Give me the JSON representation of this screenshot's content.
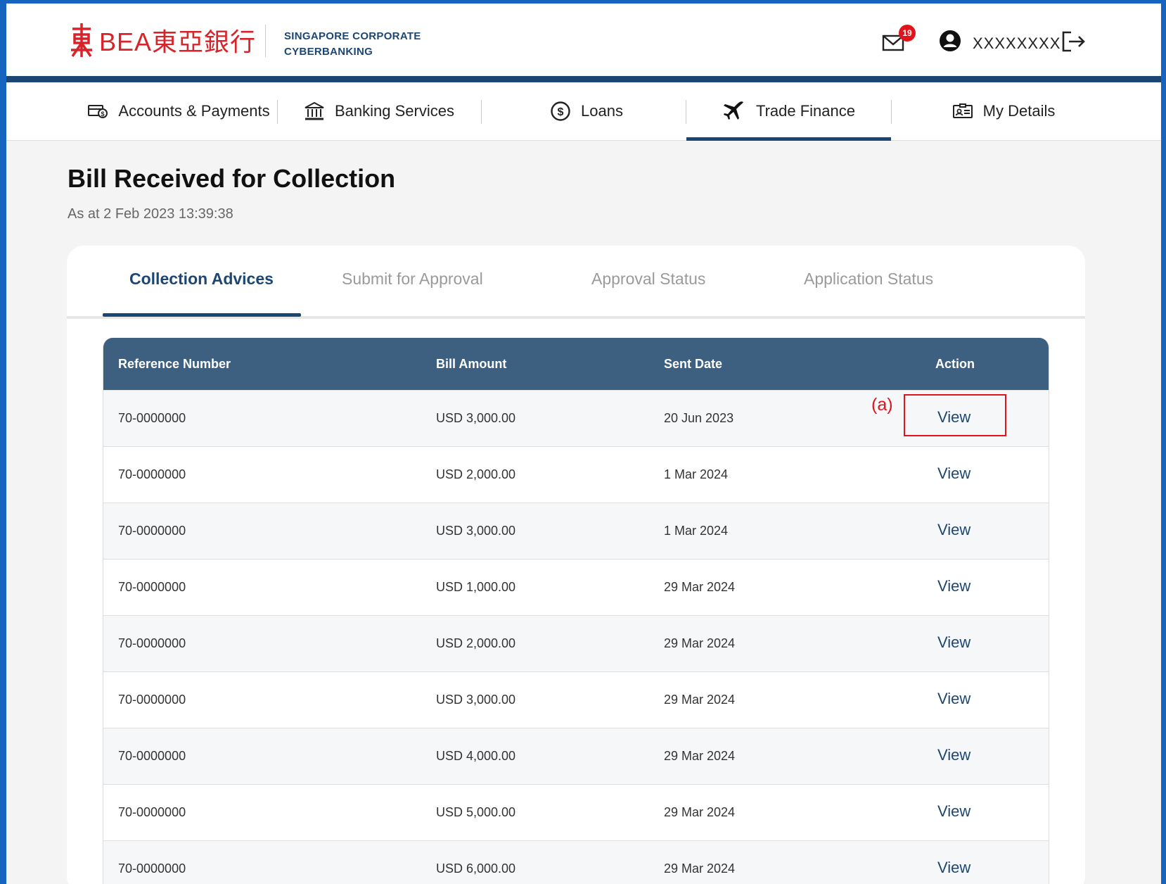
{
  "brand": {
    "logo_text": "BEA東亞銀行",
    "subtitle_line1": "SINGAPORE CORPORATE",
    "subtitle_line2": "CYBERBANKING",
    "accent": "#d8232a",
    "primary": "#1c4773"
  },
  "header": {
    "mail_badge": "19",
    "username": "XXXXXXXX"
  },
  "nav": [
    {
      "label": "Accounts & Payments",
      "icon": "card-payment-icon"
    },
    {
      "label": "Banking Services",
      "icon": "bank-building-icon"
    },
    {
      "label": "Loans",
      "icon": "dollar-coin-icon"
    },
    {
      "label": "Trade Finance",
      "icon": "airplane-icon",
      "active": true
    },
    {
      "label": "My Details",
      "icon": "id-card-icon"
    }
  ],
  "page": {
    "title": "Bill Received for Collection",
    "timestamp": "As at 2 Feb 2023 13:39:38"
  },
  "tabs": [
    {
      "label": "Collection Advices",
      "active": true
    },
    {
      "label": "Submit for Approval"
    },
    {
      "label": "Approval Status"
    },
    {
      "label": "Application Status"
    }
  ],
  "table": {
    "columns": [
      "Reference Number",
      "Bill Amount",
      "Sent Date",
      "Action"
    ],
    "rows": [
      {
        "ref": "70-0000000",
        "amount": "USD 3,000.00",
        "date": "20 Jun 2023",
        "action": "View"
      },
      {
        "ref": "70-0000000",
        "amount": "USD 2,000.00",
        "date": "1 Mar 2024",
        "action": "View"
      },
      {
        "ref": "70-0000000",
        "amount": "USD 3,000.00",
        "date": "1 Mar 2024",
        "action": "View"
      },
      {
        "ref": "70-0000000",
        "amount": "USD 1,000.00",
        "date": "29 Mar 2024",
        "action": "View"
      },
      {
        "ref": "70-0000000",
        "amount": "USD 2,000.00",
        "date": "29 Mar 2024",
        "action": "View"
      },
      {
        "ref": "70-0000000",
        "amount": "USD 3,000.00",
        "date": "29 Mar 2024",
        "action": "View"
      },
      {
        "ref": "70-0000000",
        "amount": "USD 4,000.00",
        "date": "29 Mar 2024",
        "action": "View"
      },
      {
        "ref": "70-0000000",
        "amount": "USD 5,000.00",
        "date": "29 Mar 2024",
        "action": "View"
      },
      {
        "ref": "70-0000000",
        "amount": "USD 6,000.00",
        "date": "29 Mar 2024",
        "action": "View"
      }
    ]
  },
  "annotation": {
    "label": "(a)",
    "color": "#e0141b"
  }
}
